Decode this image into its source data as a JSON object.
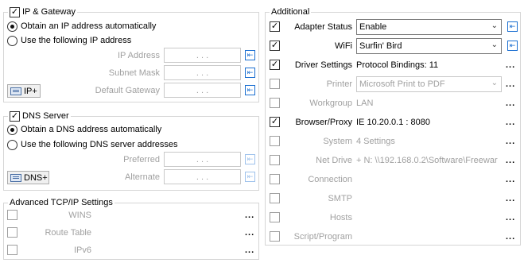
{
  "ip_gateway": {
    "title": "IP & Gateway",
    "auto_ip": "Obtain an IP address automatically",
    "manual_ip": "Use the following IP address",
    "ip_address_label": "IP Address",
    "subnet_mask_label": "Subnet Mask",
    "default_gateway_label": "Default Gateway",
    "ip_dots": ".   .   .",
    "ip_plus_label": "IP+"
  },
  "dns": {
    "title": "DNS Server",
    "auto_dns": "Obtain a DNS address automatically",
    "manual_dns": "Use the following DNS server addresses",
    "preferred_label": "Preferred",
    "alternate_label": "Alternate",
    "ip_dots": ".   .   .",
    "dns_plus_label": "DNS+"
  },
  "advanced": {
    "title": "Advanced TCP/IP Settings",
    "items": [
      {
        "label": "WINS",
        "more": "..."
      },
      {
        "label": "Route Table",
        "more": "..."
      },
      {
        "label": "IPv6",
        "more": "..."
      }
    ]
  },
  "additional": {
    "title": "Additional",
    "adapter_status": {
      "label": "Adapter Status",
      "value": "Enable"
    },
    "wifi": {
      "label": "WiFi",
      "value": "Surfin' Bird"
    },
    "driver_settings": {
      "label": "Driver Settings",
      "value": "Protocol Bindings: 11"
    },
    "printer": {
      "label": "Printer",
      "value": "Microsoft Print to PDF",
      "more": "..."
    },
    "workgroup": {
      "label": "Workgroup",
      "value": "LAN",
      "more": "..."
    },
    "browser_proxy": {
      "label": "Browser/Proxy",
      "value": "IE 10.20.0.1 : 8080",
      "more": "..."
    },
    "system": {
      "label": "System",
      "value": "4 Settings",
      "more": "..."
    },
    "net_drive": {
      "label": "Net Drive",
      "value": "+ N: \\\\192.168.0.2\\Software\\Freewar",
      "more": "..."
    },
    "connection": {
      "label": "Connection",
      "more": "..."
    },
    "smtp": {
      "label": "SMTP",
      "more": "..."
    },
    "hosts": {
      "label": "Hosts",
      "more": "..."
    },
    "script_program": {
      "label": "Script/Program",
      "more": "..."
    },
    "driver_more": "..."
  },
  "icons": {
    "checkbox_checked": "check-icon",
    "copy": "copy-arrow-icon",
    "dropdown": "chevron-down-icon",
    "network_card": "network-card-icon"
  },
  "colors": {
    "accent": "#1b6fd1",
    "disabled_text": "#a0a0a0",
    "group_border": "#d6d6d6"
  }
}
